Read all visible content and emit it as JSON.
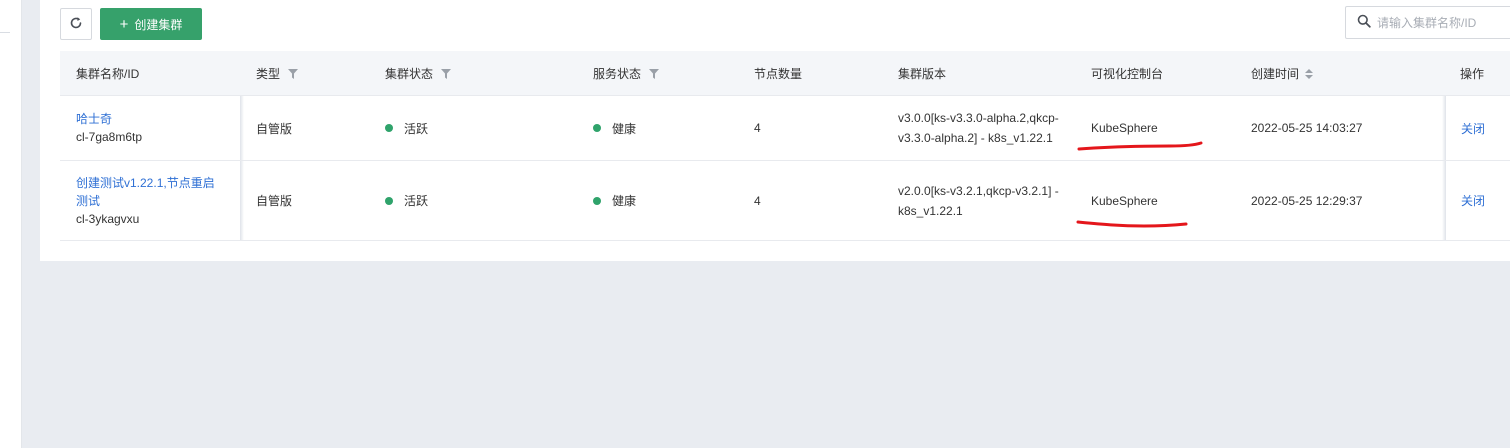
{
  "toolbar": {
    "refresh_icon": "refresh-icon",
    "create_label": "创建集群",
    "plus_icon": "plus-icon"
  },
  "search": {
    "placeholder": "请输入集群名称/ID",
    "icon": "search-icon"
  },
  "table": {
    "columns": [
      {
        "label": "集群名称/ID",
        "filter": false,
        "sort": false
      },
      {
        "label": "类型",
        "filter": true,
        "sort": false
      },
      {
        "label": "集群状态",
        "filter": true,
        "sort": false
      },
      {
        "label": "服务状态",
        "filter": true,
        "sort": false
      },
      {
        "label": "节点数量",
        "filter": false,
        "sort": false
      },
      {
        "label": "集群版本",
        "filter": false,
        "sort": false
      },
      {
        "label": "可视化控制台",
        "filter": false,
        "sort": false
      },
      {
        "label": "创建时间",
        "filter": false,
        "sort": true
      },
      {
        "label": "操作",
        "filter": false,
        "sort": false
      }
    ],
    "rows": [
      {
        "name": "哈士奇",
        "id": "cl-7ga8m6tp",
        "type": "自管版",
        "cluster_status": "活跃",
        "service_status": "健康",
        "nodes": "4",
        "version_line1": "v3.0.0[ks-v3.3.0-alpha.2,qkcp-",
        "version_line2": "v3.3.0-alpha.2] - k8s_v1.22.1",
        "console": "KubeSphere",
        "created": "2022-05-25 14:03:27",
        "action": "关闭"
      },
      {
        "name_line1": "创建测试v1.22.1,节点重启",
        "name_line2": "测试",
        "id": "cl-3ykagvxu",
        "type": "自管版",
        "cluster_status": "活跃",
        "service_status": "健康",
        "nodes": "4",
        "version_line1": "v2.0.0[ks-v3.2.1,qkcp-v3.2.1] -",
        "version_line2": "k8s_v1.22.1",
        "console": "KubeSphere",
        "created": "2022-05-25 12:29:37",
        "action": "关闭"
      }
    ]
  },
  "colors": {
    "primary_green": "#36a16b",
    "status_dot": "#2fa36b",
    "link_blue": "#2e6fd4",
    "annotation_red": "#e4161b",
    "page_background": "#e9ecf1"
  }
}
